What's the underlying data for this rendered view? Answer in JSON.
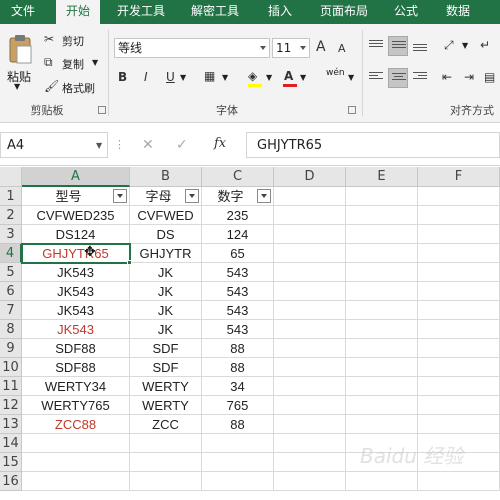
{
  "ribbon_tabs": [
    "文件",
    "开始",
    "开发工具",
    "解密工具",
    "插入",
    "页面布局",
    "公式",
    "数据"
  ],
  "active_tab_index": 1,
  "clipboard": {
    "paste_label": "粘贴",
    "cut_label": "剪切",
    "copy_label": "复制",
    "format_painter_label": "格式刷",
    "group_label": "剪贴板"
  },
  "font": {
    "font_name": "等线",
    "font_size": "11",
    "group_label": "字体",
    "bold": "B",
    "italic": "I",
    "underline": "U",
    "grow": "A",
    "shrink": "A",
    "font_color": "A",
    "phonetic": "wén"
  },
  "alignment": {
    "group_label": "对齐方式"
  },
  "formula_bar": {
    "name_box": "A4",
    "fx": "fx",
    "content": "GHJYTR65"
  },
  "columns": [
    "A",
    "B",
    "C",
    "D",
    "E",
    "F"
  ],
  "selected_column": "A",
  "rows": [
    "1",
    "2",
    "3",
    "4",
    "5",
    "6",
    "7",
    "8",
    "9",
    "10",
    "11",
    "12",
    "13",
    "14",
    "15",
    "16"
  ],
  "selected_row": "4",
  "headers": [
    "型号",
    "字母",
    "数字"
  ],
  "table": [
    {
      "a": "CVFWED235",
      "b": "CVFWED",
      "c": "235",
      "red": false
    },
    {
      "a": "DS124",
      "b": "DS",
      "c": "124",
      "red": false
    },
    {
      "a": "GHJYTR65",
      "b": "GHJYTR",
      "c": "65",
      "red": true
    },
    {
      "a": "JK543",
      "b": "JK",
      "c": "543",
      "red": false
    },
    {
      "a": "JK543",
      "b": "JK",
      "c": "543",
      "red": false
    },
    {
      "a": "JK543",
      "b": "JK",
      "c": "543",
      "red": false
    },
    {
      "a": "JK543",
      "b": "JK",
      "c": "543",
      "red": true
    },
    {
      "a": "SDF88",
      "b": "SDF",
      "c": "88",
      "red": false
    },
    {
      "a": "SDF88",
      "b": "SDF",
      "c": "88",
      "red": false
    },
    {
      "a": "WERTY34",
      "b": "WERTY",
      "c": "34",
      "red": false
    },
    {
      "a": "WERTY765",
      "b": "WERTY",
      "c": "765",
      "red": false
    },
    {
      "a": "ZCC88",
      "b": "ZCC",
      "c": "88",
      "red": true
    }
  ],
  "colors": {
    "excel_green": "#217346",
    "duplicate_red": "#c0392b"
  },
  "watermark": "Baidu 经验"
}
